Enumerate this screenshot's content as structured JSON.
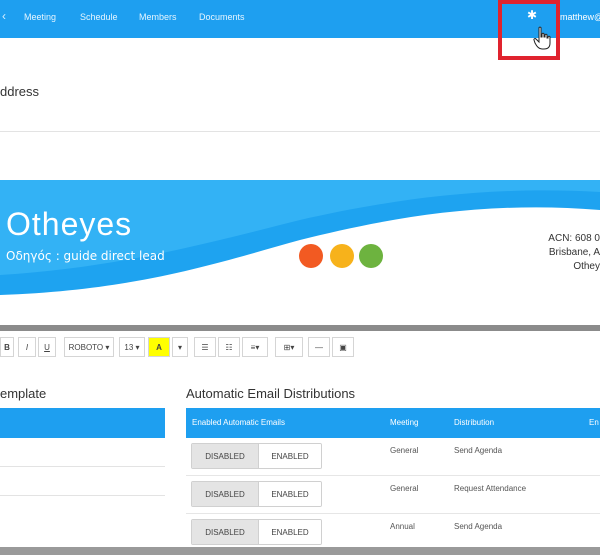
{
  "nav": {
    "items": [
      "Meeting",
      "Schedule",
      "Members",
      "Documents"
    ],
    "user": "matthew@"
  },
  "page": {
    "address_label": "ddress"
  },
  "banner": {
    "logo_text": "Otheyes",
    "tagline": "Οδηγός : guide direct lead",
    "contact_lines": [
      "ACN: 608 0",
      "Brisbane, A",
      "Othey"
    ],
    "dot_colors": [
      "#f25a22",
      "#f7b21b",
      "#6db33f"
    ]
  },
  "toolbar": {
    "bold": "B",
    "italic": "I",
    "underline": "U",
    "font": "ROBOTO ▾",
    "size": "13 ▾",
    "color": "A",
    "color_caret": "▾",
    "table": "⊞▾",
    "hr": "—"
  },
  "template_section": {
    "title": "emplate"
  },
  "distributions": {
    "title": "Automatic Email Distributions",
    "columns": [
      "Enabled Automatic Emails",
      "Meeting",
      "Distribution",
      "En"
    ],
    "rows": [
      {
        "disabled": "DISABLED",
        "enabled": "ENABLED",
        "meeting": "General",
        "distribution": "Send Agenda"
      },
      {
        "disabled": "DISABLED",
        "enabled": "ENABLED",
        "meeting": "General",
        "distribution": "Request Attendance"
      },
      {
        "disabled": "DISABLED",
        "enabled": "ENABLED",
        "meeting": "Annual",
        "distribution": "Send Agenda"
      }
    ]
  },
  "colors": {
    "primary": "#1e9ff0",
    "highlight": "#e0232e"
  },
  "icons": [
    "settings-gear-icon",
    "hand-cursor-icon",
    "list-icon",
    "ordered-list-icon",
    "align-icon",
    "table-icon",
    "image-icon"
  ]
}
